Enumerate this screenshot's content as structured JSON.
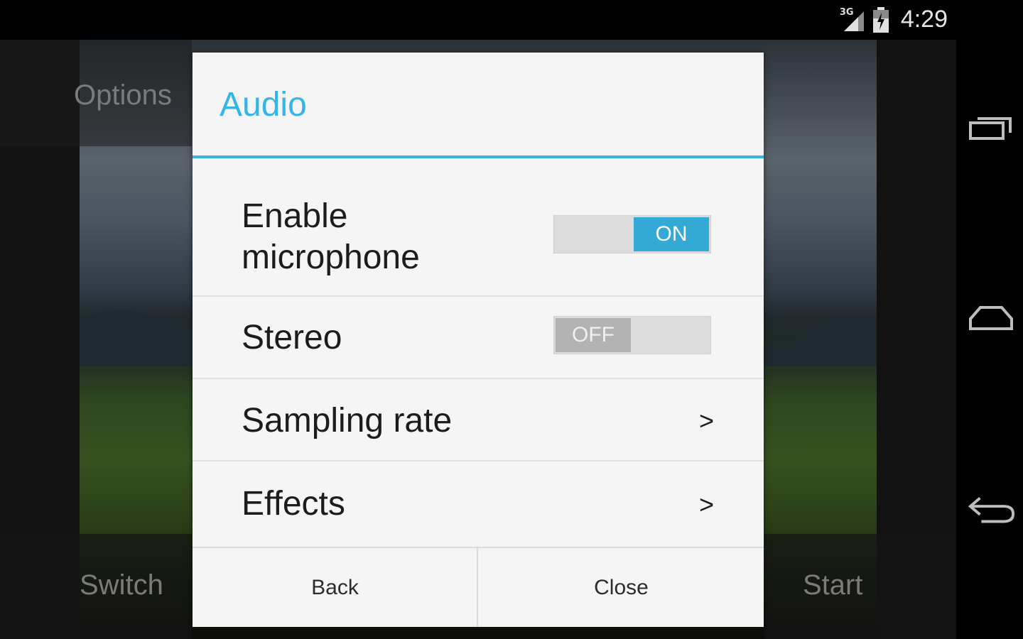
{
  "status_bar": {
    "network": "3G",
    "time": "4:29",
    "icons": [
      "signal-icon",
      "battery-icon"
    ]
  },
  "background": {
    "options_label": "Options",
    "switch_label": "Switch",
    "start_label": "Start"
  },
  "nav_bar": {
    "icons": [
      "recent-apps-icon",
      "home-icon",
      "back-icon"
    ]
  },
  "dialog": {
    "title": "Audio",
    "accent_color": "#33b5e5",
    "items": [
      {
        "label": "Enable microphone",
        "type": "toggle",
        "state": "ON"
      },
      {
        "label": "Stereo",
        "type": "toggle",
        "state": "OFF"
      },
      {
        "label": "Sampling rate",
        "type": "submenu",
        "chevron": ">"
      },
      {
        "label": "Effects",
        "type": "submenu",
        "chevron": ">"
      }
    ],
    "buttons": {
      "back": "Back",
      "close": "Close"
    }
  }
}
